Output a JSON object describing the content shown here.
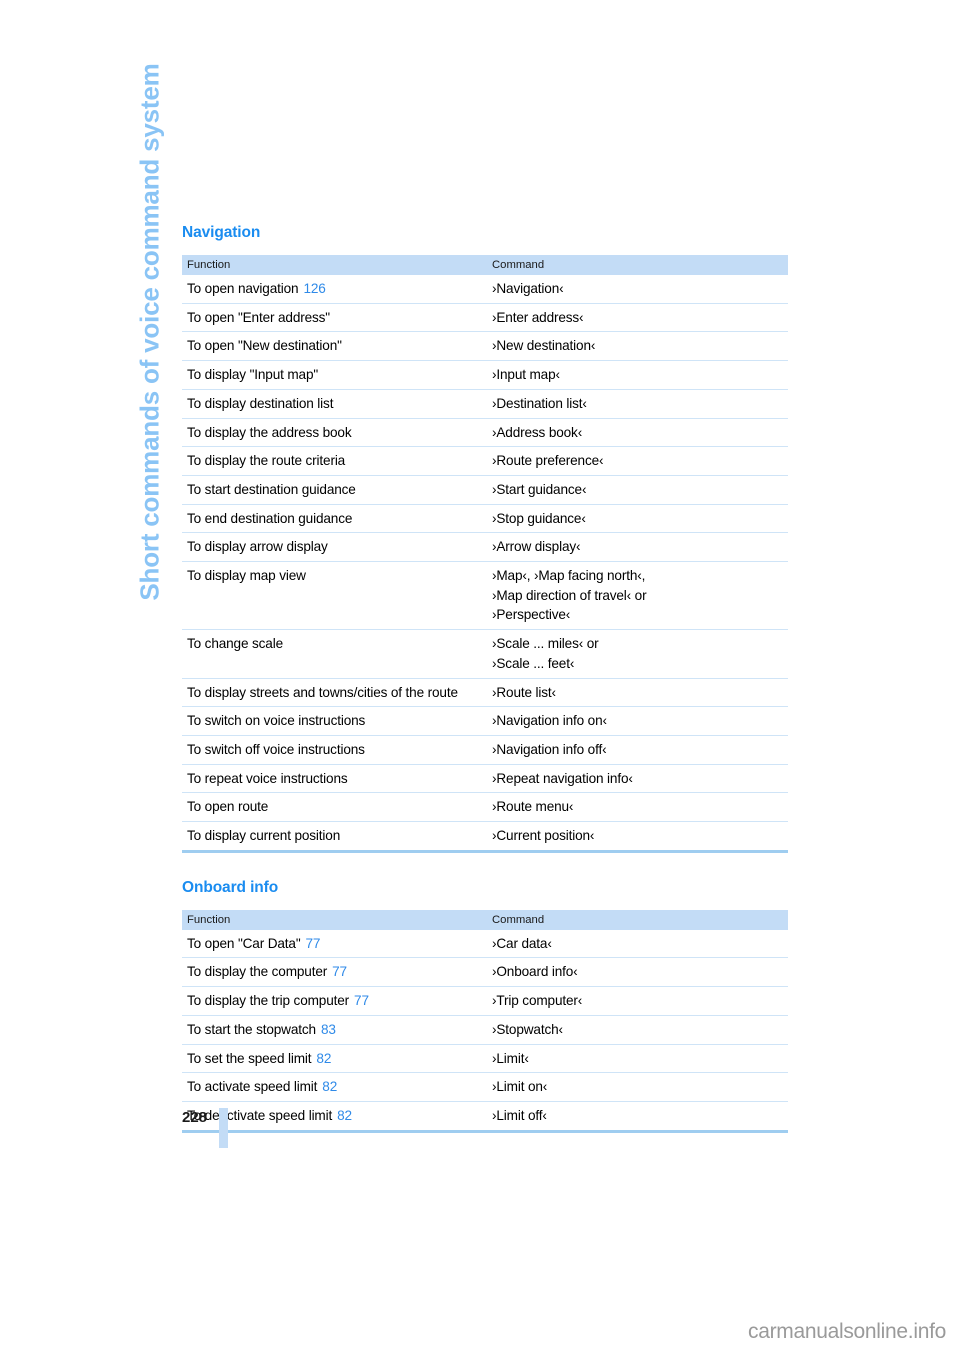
{
  "side_title": "Short commands of voice command system",
  "page_number": "228",
  "footer": "carmanualsonline.info",
  "colors": {
    "heading_blue": "#1a8cf0",
    "side_title_blue": "#8ac4f5",
    "table_header_bg": "#c3dcf6",
    "row_rule": "#cfe4f7",
    "table_bottom_rule": "#9fcdf0",
    "page_ref_blue": "#2f8ae8"
  },
  "sections": [
    {
      "heading": "Navigation",
      "columns": [
        "Function",
        "Command"
      ],
      "rows": [
        {
          "function": "To open navigation",
          "page": "126",
          "command": [
            "›Navigation‹"
          ]
        },
        {
          "function": "To open \"Enter address\"",
          "page": "",
          "command": [
            "›Enter address‹"
          ]
        },
        {
          "function": "To open \"New destination\"",
          "page": "",
          "command": [
            "›New destination‹"
          ]
        },
        {
          "function": "To display \"Input map\"",
          "page": "",
          "command": [
            "›Input map‹"
          ]
        },
        {
          "function": "To display destination list",
          "page": "",
          "command": [
            "›Destination list‹"
          ]
        },
        {
          "function": "To display the address book",
          "page": "",
          "command": [
            "›Address book‹"
          ]
        },
        {
          "function": "To display the route criteria",
          "page": "",
          "command": [
            "›Route preference‹"
          ]
        },
        {
          "function": "To start destination guidance",
          "page": "",
          "command": [
            "›Start guidance‹"
          ]
        },
        {
          "function": "To end destination guidance",
          "page": "",
          "command": [
            "›Stop guidance‹"
          ]
        },
        {
          "function": "To display arrow display",
          "page": "",
          "command": [
            "›Arrow display‹"
          ]
        },
        {
          "function": "To display map view",
          "page": "",
          "command": [
            "›Map‹, ›Map facing north‹,",
            "›Map direction of travel‹ or",
            "›Perspective‹"
          ]
        },
        {
          "function": "To change scale",
          "page": "",
          "command": [
            "›Scale ... miles‹ or",
            "›Scale ... feet‹"
          ]
        },
        {
          "function": "To display streets and towns/cities of the route",
          "page": "",
          "command": [
            "›Route list‹"
          ]
        },
        {
          "function": "To switch on voice instructions",
          "page": "",
          "command": [
            "›Navigation info on‹"
          ]
        },
        {
          "function": "To switch off voice instructions",
          "page": "",
          "command": [
            "›Navigation info off‹"
          ]
        },
        {
          "function": "To repeat voice instructions",
          "page": "",
          "command": [
            "›Repeat navigation info‹"
          ]
        },
        {
          "function": "To open route",
          "page": "",
          "command": [
            "›Route menu‹"
          ]
        },
        {
          "function": "To display current position",
          "page": "",
          "command": [
            "›Current position‹"
          ]
        }
      ]
    },
    {
      "heading": "Onboard info",
      "columns": [
        "Function",
        "Command"
      ],
      "rows": [
        {
          "function": "To open \"Car Data\"",
          "page": "77",
          "command": [
            "›Car data‹"
          ]
        },
        {
          "function": "To display the computer",
          "page": "77",
          "command": [
            "›Onboard info‹"
          ]
        },
        {
          "function": "To display the trip computer",
          "page": "77",
          "command": [
            "›Trip computer‹"
          ]
        },
        {
          "function": "To start the stopwatch",
          "page": "83",
          "command": [
            "›Stopwatch‹"
          ]
        },
        {
          "function": "To set the speed limit",
          "page": "82",
          "command": [
            "›Limit‹"
          ]
        },
        {
          "function": "To activate speed limit",
          "page": "82",
          "command": [
            "›Limit on‹"
          ]
        },
        {
          "function": "To deactivate speed limit",
          "page": "82",
          "command": [
            "›Limit off‹"
          ]
        }
      ]
    }
  ]
}
